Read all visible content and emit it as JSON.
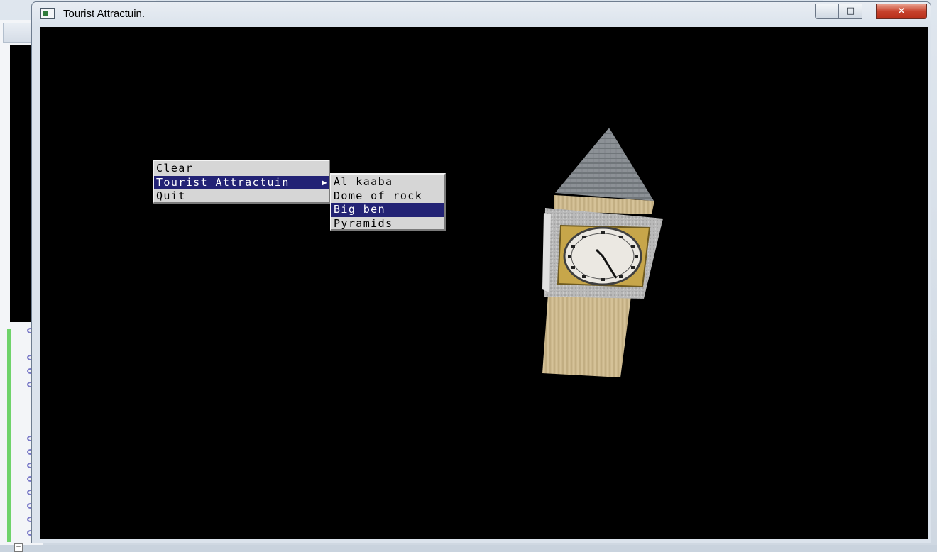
{
  "window": {
    "title": "Tourist Attractuin.",
    "controls": {
      "minimize": "—",
      "maximize": "□",
      "close": "✕"
    }
  },
  "menu": {
    "items": [
      {
        "label": "Clear"
      },
      {
        "label": "Tourist Attractuin",
        "submenu_arrow": "▶"
      },
      {
        "label": "Quit"
      }
    ],
    "selected_index": 1
  },
  "submenu": {
    "items": [
      {
        "label": "Al kaaba"
      },
      {
        "label": "Dome of rock"
      },
      {
        "label": "Big ben"
      },
      {
        "label": "Pyramids"
      }
    ],
    "selected_index": 2
  },
  "scene": {
    "model": "big-ben-tower",
    "colors": {
      "background": "#000000",
      "roof": "#8a8f94",
      "tower": "#cdb98e",
      "clock_frame": "#b9b9b9",
      "clock_gold": "#c8a84a",
      "clock_face": "#e9e7e2"
    }
  },
  "icons": {
    "window": "app-window-icon",
    "submenu": "submenu-arrow-icon"
  }
}
